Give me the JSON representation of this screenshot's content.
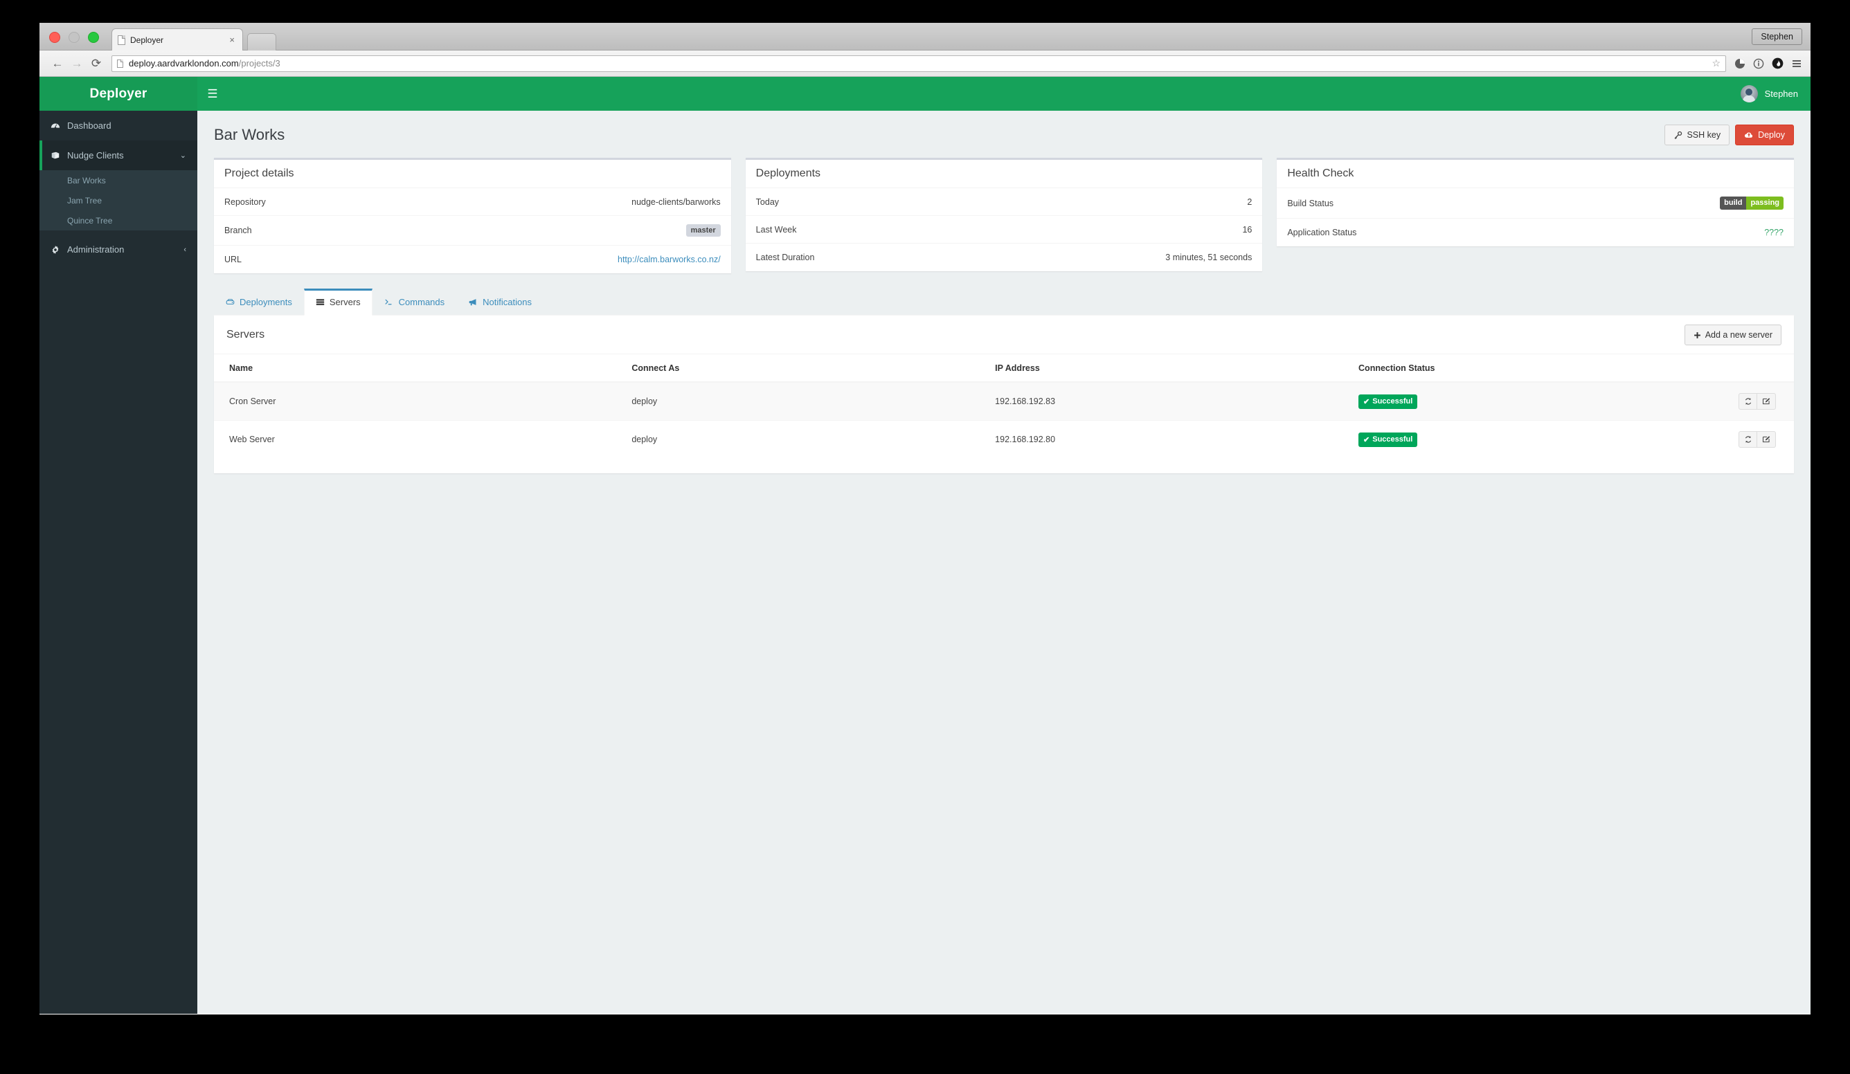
{
  "browser": {
    "tab_title": "Deployer",
    "tab_close_glyph": "×",
    "profile_name": "Stephen",
    "back_glyph": "←",
    "forward_glyph": "→",
    "reload_glyph": "⟳",
    "url_host": "deploy.aardvarklondon.com",
    "url_path": "/projects/3",
    "star_glyph": "☆"
  },
  "sidebar": {
    "brand": "Deployer",
    "items": [
      {
        "label": "Dashboard",
        "icon": "dashboard-icon",
        "caret": ""
      },
      {
        "label": "Nudge Clients",
        "icon": "book-icon",
        "caret": "⌄"
      },
      {
        "label": "Administration",
        "icon": "gear-icon",
        "caret": "‹"
      }
    ],
    "submenu": [
      {
        "label": "Bar Works"
      },
      {
        "label": "Jam Tree"
      },
      {
        "label": "Quince Tree"
      }
    ]
  },
  "navbar": {
    "toggle_glyph": "☰",
    "user_name": "Stephen"
  },
  "page": {
    "title": "Bar Works",
    "actions": [
      {
        "label": "SSH key",
        "icon": "key-icon",
        "style": "default"
      },
      {
        "label": "Deploy",
        "icon": "cloud-upload-icon",
        "style": "danger"
      }
    ]
  },
  "boxes": {
    "project_details": {
      "title": "Project details",
      "rows": [
        {
          "label": "Repository",
          "value": "nudge-clients/barworks",
          "type": "text"
        },
        {
          "label": "Branch",
          "value": "master",
          "type": "badge"
        },
        {
          "label": "URL",
          "value": "http://calm.barworks.co.nz/",
          "type": "link"
        }
      ]
    },
    "deployments": {
      "title": "Deployments",
      "rows": [
        {
          "label": "Today",
          "value": "2",
          "type": "text"
        },
        {
          "label": "Last Week",
          "value": "16",
          "type": "text"
        },
        {
          "label": "Latest Duration",
          "value": "3 minutes, 51 seconds",
          "type": "text"
        }
      ]
    },
    "health_check": {
      "title": "Health Check",
      "rows": [
        {
          "label": "Build Status",
          "type": "shield",
          "shield_left": "build",
          "shield_right": "passing"
        },
        {
          "label": "Application Status",
          "type": "unknown",
          "value": "????"
        }
      ]
    }
  },
  "tabs": [
    {
      "label": "Deployments",
      "icon": "hdd-icon",
      "active": false
    },
    {
      "label": "Servers",
      "icon": "server-icon",
      "active": true
    },
    {
      "label": "Commands",
      "icon": "terminal-icon",
      "active": false
    },
    {
      "label": "Notifications",
      "icon": "bullhorn-icon",
      "active": false
    }
  ],
  "servers_panel": {
    "title": "Servers",
    "add_button": {
      "label": "Add a new server",
      "icon": "plus-icon"
    },
    "columns": [
      "Name",
      "Connect As",
      "IP Address",
      "Connection Status",
      ""
    ],
    "rows": [
      {
        "name": "Cron Server",
        "connect_as": "deploy",
        "ip_address": "192.168.192.83",
        "status": "Successful",
        "status_check": "✔",
        "actions": [
          "refresh-icon",
          "edit-icon"
        ]
      },
      {
        "name": "Web Server",
        "connect_as": "deploy",
        "ip_address": "192.168.192.80",
        "status": "Successful",
        "status_check": "✔",
        "actions": [
          "refresh-icon",
          "edit-icon"
        ]
      }
    ]
  },
  "colors": {
    "brand_green": "#16a25a",
    "sidebar_dark": "#222d32",
    "sidebar_submenu": "#2c3b41",
    "danger_red": "#dd4b39",
    "link_blue": "#3c8dbc",
    "success_green": "#00a65a",
    "shield_green": "#7dbd1f",
    "shield_gray": "#555555",
    "content_bg": "#ecf0f1"
  }
}
